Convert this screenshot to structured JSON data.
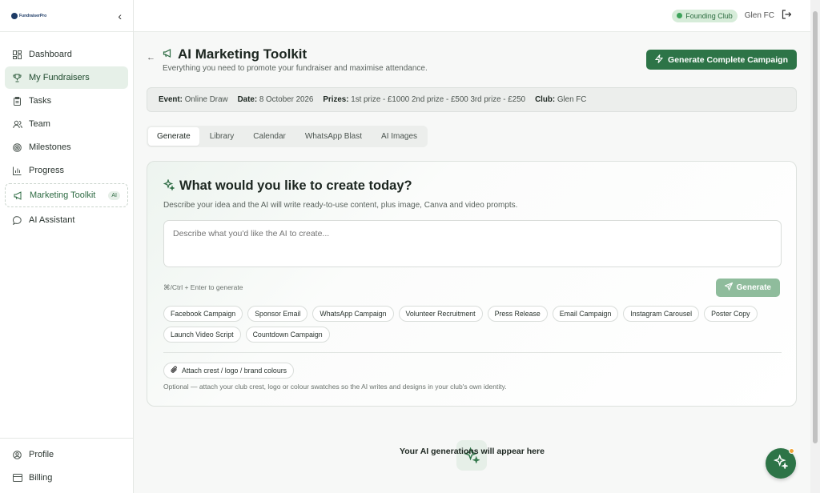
{
  "app": {
    "logo_text": "FundraiserPro"
  },
  "sidebar": {
    "items": [
      {
        "label": "Dashboard",
        "icon": "grid-icon"
      },
      {
        "label": "My Fundraisers",
        "icon": "trophy-icon"
      },
      {
        "label": "Tasks",
        "icon": "clipboard-icon"
      },
      {
        "label": "Team",
        "icon": "users-icon"
      },
      {
        "label": "Milestones",
        "icon": "target-icon"
      },
      {
        "label": "Progress",
        "icon": "bar-chart-icon"
      },
      {
        "label": "Marketing Toolkit",
        "icon": "megaphone-icon",
        "badge": "AI"
      },
      {
        "label": "AI Assistant",
        "icon": "chat-icon"
      }
    ],
    "bottom": [
      {
        "label": "Profile",
        "icon": "user-circle-icon"
      },
      {
        "label": "Billing",
        "icon": "card-icon"
      }
    ]
  },
  "topbar": {
    "badge": "Founding Club",
    "club": "Glen FC"
  },
  "header": {
    "title": "AI Marketing Toolkit",
    "subtitle": "Everything you need to promote your fundraiser and maximise attendance.",
    "cta": "Generate Complete Campaign"
  },
  "event": {
    "event_label": "Event:",
    "event_value": "Online Draw",
    "date_label": "Date:",
    "date_value": "8 October 2026",
    "prizes_label": "Prizes:",
    "prizes_value": "1st prize - £1000 2nd prize - £500 3rd prize - £250",
    "club_label": "Club:",
    "club_value": "Glen FC"
  },
  "tabs": [
    "Generate",
    "Library",
    "Calendar",
    "WhatsApp Blast",
    "AI Images"
  ],
  "card": {
    "title": "What would you like to create today?",
    "description": "Describe your idea and the AI will write ready-to-use content, plus image, Canva and video prompts.",
    "placeholder": "Describe what you'd like the AI to create...",
    "hint": "⌘/Ctrl + Enter to generate",
    "generate": "Generate",
    "chips": [
      "Facebook Campaign",
      "Sponsor Email",
      "WhatsApp Campaign",
      "Volunteer Recruitment",
      "Press Release",
      "Email Campaign",
      "Instagram Carousel",
      "Poster Copy",
      "Launch Video Script",
      "Countdown Campaign"
    ],
    "attach": "Attach crest / logo / brand colours",
    "optional": "Optional — attach your club crest, logo or colour swatches so the AI writes and designs in your club's own identity."
  },
  "empty": {
    "text": "Your AI generations will appear here"
  },
  "colors": {
    "brand": "#2d7447",
    "accent_light": "#e6f0e8"
  }
}
